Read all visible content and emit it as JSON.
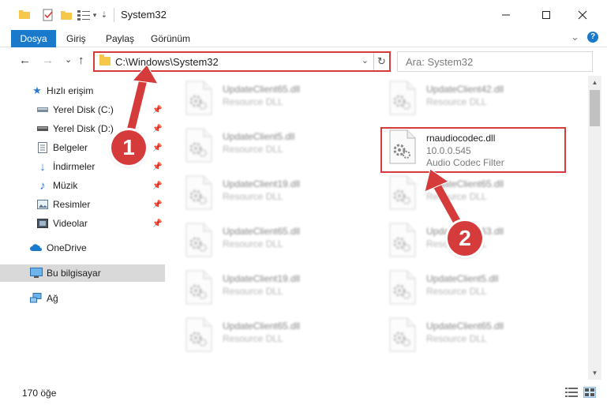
{
  "window": {
    "title": "System32",
    "minimize": "—",
    "maximize": "☐",
    "close": "✕"
  },
  "ribbon": {
    "tabs": [
      "Dosya",
      "Giriş",
      "Paylaş",
      "Görünüm"
    ],
    "collapse": "⌄",
    "help": "?"
  },
  "address": {
    "path": "C:\\Windows\\System32",
    "dropdown": "⌄",
    "refresh": "↻",
    "back": "←",
    "forward": "→",
    "recent": "⌄",
    "up": "↑"
  },
  "search": {
    "placeholder": "Ara: System32",
    "icon": "search-icon"
  },
  "sidebar": {
    "items": [
      {
        "label": "Hızlı erişim",
        "icon": "star-icon",
        "pinned": false
      },
      {
        "label": "Yerel Disk (C:)",
        "icon": "drive-icon",
        "pinned": true
      },
      {
        "label": "Yerel Disk (D:)",
        "icon": "drive-icon",
        "pinned": true
      },
      {
        "label": "Belgeler",
        "icon": "document-icon",
        "pinned": true
      },
      {
        "label": "İndirmeler",
        "icon": "download-icon",
        "pinned": true
      },
      {
        "label": "Müzik",
        "icon": "music-icon",
        "pinned": true
      },
      {
        "label": "Resimler",
        "icon": "picture-icon",
        "pinned": true
      },
      {
        "label": "Videolar",
        "icon": "video-icon",
        "pinned": true
      },
      {
        "label": "OneDrive",
        "icon": "cloud-icon",
        "pinned": false
      },
      {
        "label": "Bu bilgisayar",
        "icon": "computer-icon",
        "pinned": false,
        "selected": true
      },
      {
        "label": "Ağ",
        "icon": "network-icon",
        "pinned": false
      }
    ]
  },
  "files": {
    "left": [
      {
        "name": "UpdateClient65.dll",
        "type": "Resource DLL"
      },
      {
        "name": "UpdateClient5.dll",
        "type": "Resource DLL"
      },
      {
        "name": "UpdateClient19.dll",
        "type": "Resource DLL"
      },
      {
        "name": "UpdateClient65.dll",
        "type": "Resource DLL"
      },
      {
        "name": "UpdateClient19.dll",
        "type": "Resource DLL"
      },
      {
        "name": "UpdateClient65.dll",
        "type": "Resource DLL"
      }
    ],
    "right": [
      {
        "name": "UpdateClient42.dll",
        "type": "Resource DLL"
      },
      {
        "name": "rnaudiocodec.dll",
        "version": "10.0.0.545",
        "type": "Audio Codec Filter",
        "highlighted": true
      },
      {
        "name": "UpdateClient65.dll",
        "type": "Resource DLL"
      },
      {
        "name": "UpdateClient63.dll",
        "type": "Resource DLL"
      },
      {
        "name": "UpdateClient5.dll",
        "type": "Resource DLL"
      },
      {
        "name": "UpdateClient65.dll",
        "type": "Resource DLL"
      }
    ]
  },
  "status": {
    "count": "170 öğe"
  },
  "annotations": {
    "marker1": "1",
    "marker2": "2",
    "color": "#d63b3b"
  },
  "colors": {
    "accent": "#1979ca",
    "folder": "#f5c84c",
    "highlight": "#d63b3b"
  }
}
